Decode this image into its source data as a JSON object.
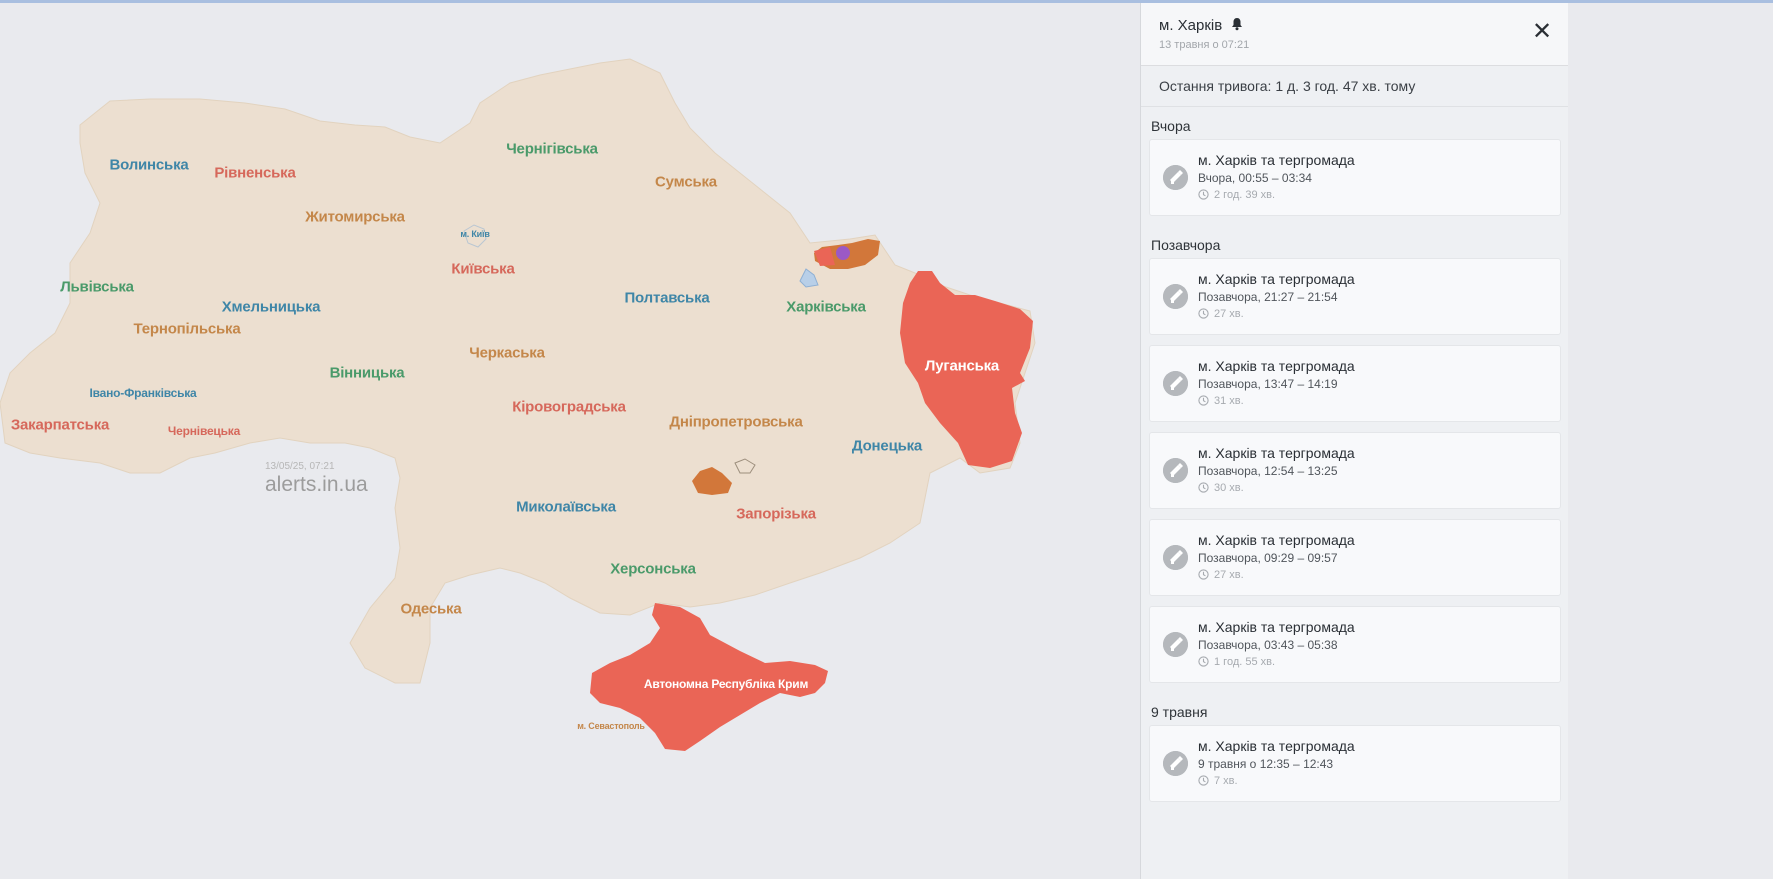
{
  "map": {
    "watermark_date": "13/05/25, 07:21",
    "watermark_site": "alerts.in.ua",
    "colors": {
      "land": "#ecdfd0",
      "border": "#d9c9b4",
      "alert": "#ea6556",
      "threat": "#d2773a",
      "water": "#e9eaee"
    },
    "regions": {
      "volynska": "Волинська",
      "rivnenska": "Рівненська",
      "zhytomyrska": "Житомирська",
      "chernihivska": "Чернігівська",
      "sumska": "Сумська",
      "lvivska": "Львівська",
      "khmelnytska": "Хмельницька",
      "ternopilska": "Тернопільська",
      "kyivska": "Київська",
      "kyiv_city": "м. Київ",
      "poltavska": "Полтавська",
      "kharkivska": "Харківська",
      "luhanska": "Луганська",
      "vinnytska": "Вінницька",
      "cherkaska": "Черкаська",
      "ivano_frankivska": "Івано-Франківська",
      "zakarpatska": "Закарпатська",
      "chernivetska": "Чернівецька",
      "kirovohradska": "Кіровоградська",
      "dnipropetrovska": "Дніпропетровська",
      "donetska": "Донецька",
      "mykolaivska": "Миколаївська",
      "zaporizka": "Запорізька",
      "khersonska": "Херсонська",
      "odeska": "Одеська",
      "krym": "Автономна Республіка Крим",
      "sevastopol": "м. Севастополь"
    }
  },
  "panel": {
    "title": "м. Харків",
    "subtitle": "13 травня о 07:21",
    "close_icon": "close-icon",
    "last_alert": "Остання тривога: 1 д. 3 год. 47 хв. тому",
    "groups": [
      {
        "heading": "Вчора",
        "items": [
          {
            "title": "м. Харків та тергромада",
            "time": "Вчора, 00:55 – 03:34",
            "duration": "2 год. 39 хв."
          }
        ]
      },
      {
        "heading": "Позавчора",
        "items": [
          {
            "title": "м. Харків та тергромада",
            "time": "Позавчора, 21:27 – 21:54",
            "duration": "27 хв."
          },
          {
            "title": "м. Харків та тергромада",
            "time": "Позавчора, 13:47 – 14:19",
            "duration": "31 хв."
          },
          {
            "title": "м. Харків та тергромада",
            "time": "Позавчора, 12:54 – 13:25",
            "duration": "30 хв."
          },
          {
            "title": "м. Харків та тергромада",
            "time": "Позавчора, 09:29 – 09:57",
            "duration": "27 хв."
          },
          {
            "title": "м. Харків та тергромада",
            "time": "Позавчора, 03:43 – 05:38",
            "duration": "1 год. 55 хв."
          }
        ]
      },
      {
        "heading": "9 травня",
        "items": [
          {
            "title": "м. Харків та тергромада",
            "time": "9 травня о 12:35 – 12:43",
            "duration": "7 хв."
          }
        ]
      }
    ]
  }
}
